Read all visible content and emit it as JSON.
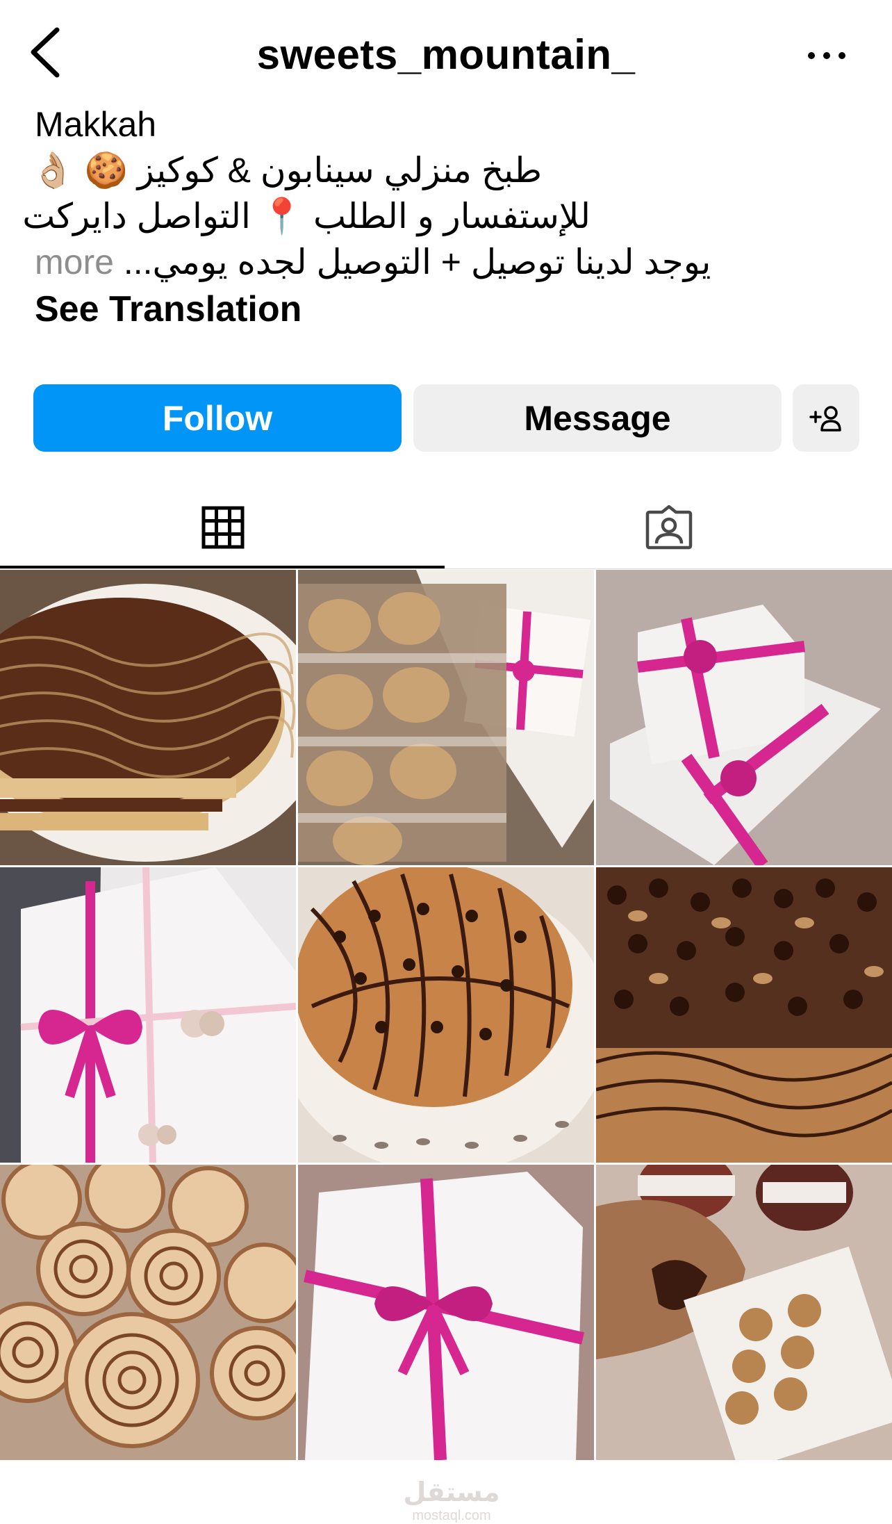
{
  "header": {
    "username": "sweets_mountain_",
    "back_icon": "chevron-left-icon",
    "more_icon": "ellipsis-icon"
  },
  "bio": {
    "location": "Makkah",
    "line1": "طبخ منزلي سينابون & كوكيز 🍪 👌🏼",
    "line2": "للإستفسار و الطلب 📍 التواصل دايركت",
    "line3": "يوجد لدينا توصيل + التوصيل لجده يومي...",
    "more_label": "more",
    "see_translation": "See Translation"
  },
  "actions": {
    "follow_label": "Follow",
    "message_label": "Message",
    "add_user_icon": "person-add-icon"
  },
  "tabs": {
    "grid_icon": "grid-icon",
    "tagged_icon": "tagged-person-icon"
  },
  "colors": {
    "follow_blue": "#0095f6",
    "button_gray": "#efefef",
    "ribbon_pink": "#d6268f",
    "chocolate": "#4a2414",
    "cookie": "#d8a866"
  },
  "posts": [
    {
      "name": "post-chocolate-cookie-cake"
    },
    {
      "name": "post-wrapped-cookies-box"
    },
    {
      "name": "post-gift-boxes-pink-ribbon"
    },
    {
      "name": "post-white-box-pink-bow"
    },
    {
      "name": "post-chocolate-chip-cookie-pizza"
    },
    {
      "name": "post-chocolate-drizzle-closeup"
    },
    {
      "name": "post-cinnamon-rolls"
    },
    {
      "name": "post-box-pink-ribbon-watermark"
    },
    {
      "name": "post-nutella-cookie"
    }
  ],
  "watermark": {
    "text_ar": "مستقل",
    "text_en": "mostaql.com"
  }
}
